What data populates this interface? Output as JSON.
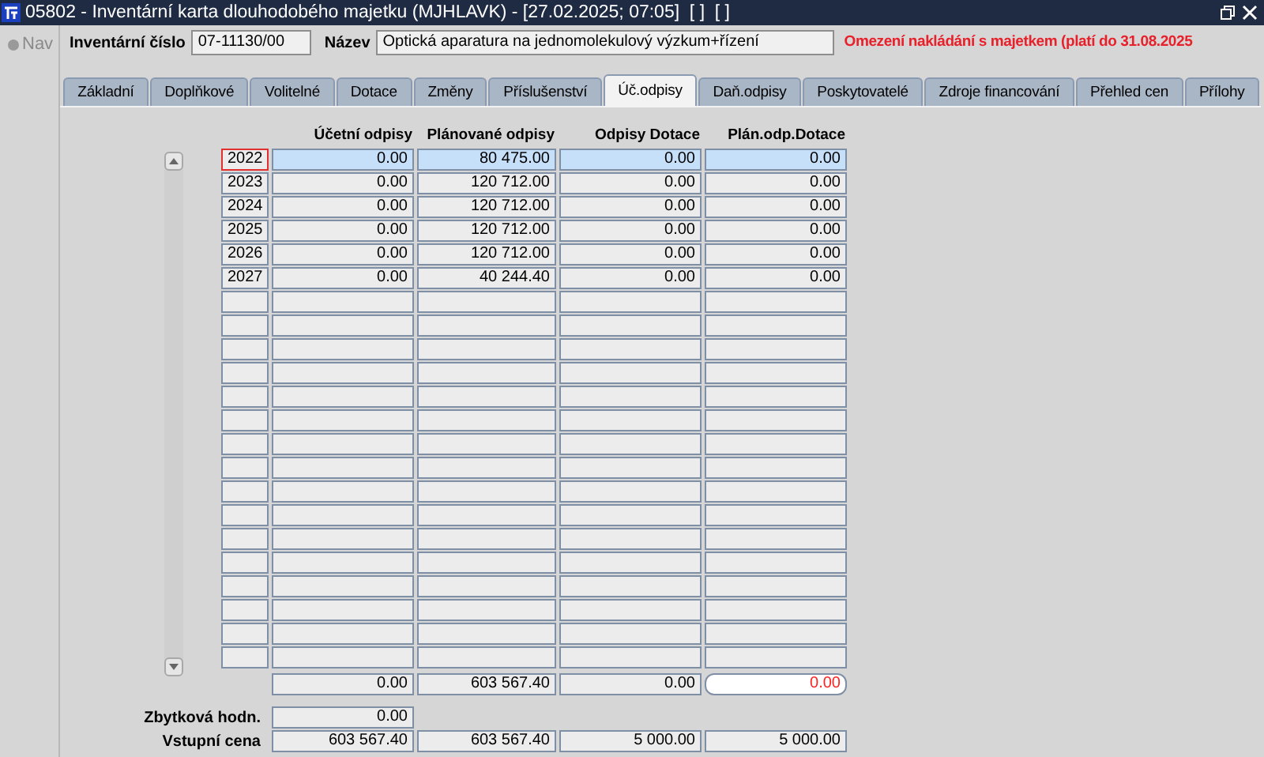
{
  "window": {
    "title": "05802 - Inventární karta dlouhodobého majetku (MJHLAVK) - [27.02.2025; 07:05]  [ ]  [ ]"
  },
  "nav": {
    "label": "Nav",
    "checked": false
  },
  "header": {
    "fields": [
      {
        "label": "Inventární číslo",
        "value": "07-11130/00"
      },
      {
        "label": "Název",
        "value": "Optická aparatura na jednomolekulový výzkum+řízení"
      }
    ],
    "warning": "Omezení nakládání s majetkem (platí do 31.08.2025"
  },
  "tabs": [
    {
      "label": "Základní",
      "selected": false
    },
    {
      "label": "Doplňkové",
      "selected": false
    },
    {
      "label": "Volitelné",
      "selected": false
    },
    {
      "label": "Dotace",
      "selected": false
    },
    {
      "label": "Změny",
      "selected": false
    },
    {
      "label": "Příslušenství",
      "selected": false
    },
    {
      "label": "Úč.odpisy",
      "selected": true
    },
    {
      "label": "Daň.odpisy",
      "selected": false
    },
    {
      "label": "Poskytovatelé",
      "selected": false
    },
    {
      "label": "Zdroje financování",
      "selected": false
    },
    {
      "label": "Přehled cen",
      "selected": false
    },
    {
      "label": "Přílohy",
      "selected": false
    }
  ],
  "table": {
    "columns": [
      "Účetní odpisy",
      "Plánované odpisy",
      "Odpisy Dotace",
      "Plán.odp.Dotace"
    ],
    "rows": [
      {
        "year": "2022",
        "values": [
          "0.00",
          "80 475.00",
          "0.00",
          "0.00"
        ],
        "selected": true,
        "focused": true
      },
      {
        "year": "2023",
        "values": [
          "0.00",
          "120 712.00",
          "0.00",
          "0.00"
        ],
        "selected": false,
        "focused": false
      },
      {
        "year": "2024",
        "values": [
          "0.00",
          "120 712.00",
          "0.00",
          "0.00"
        ],
        "selected": false,
        "focused": false
      },
      {
        "year": "2025",
        "values": [
          "0.00",
          "120 712.00",
          "0.00",
          "0.00"
        ],
        "selected": false,
        "focused": false
      },
      {
        "year": "2026",
        "values": [
          "0.00",
          "120 712.00",
          "0.00",
          "0.00"
        ],
        "selected": false,
        "focused": false
      },
      {
        "year": "2027",
        "values": [
          "0.00",
          "40 244.40",
          "0.00",
          "0.00"
        ],
        "selected": false,
        "focused": false
      }
    ],
    "totals": [
      {
        "value": "0.00",
        "alert": false
      },
      {
        "value": "603 567.40",
        "alert": false
      },
      {
        "value": "0.00",
        "alert": false
      },
      {
        "value": "0.00",
        "alert": true
      }
    ]
  },
  "summary": [
    {
      "label": "Zbytková hodn.",
      "values": [
        "0.00"
      ]
    },
    {
      "label": "Vstupní cena",
      "values": [
        "603 567.40",
        "603 567.40",
        "5 000.00",
        "5 000.00"
      ]
    }
  ]
}
